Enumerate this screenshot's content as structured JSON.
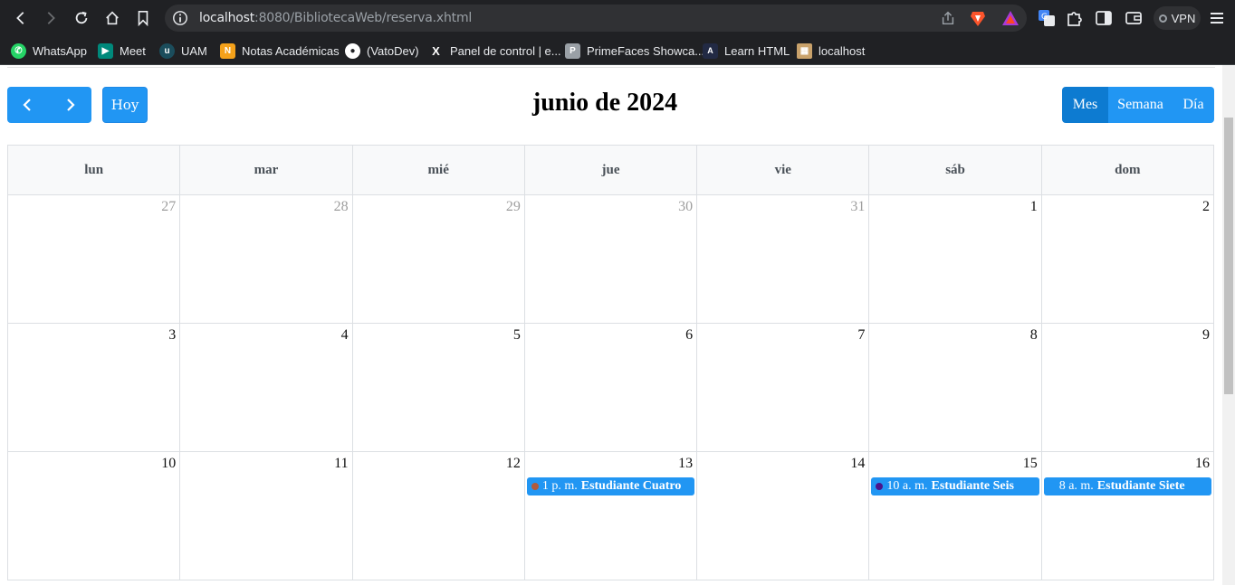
{
  "browser": {
    "url_host": "localhost",
    "url_rest": ":8080/BibliotecaWeb/reserva.xhtml",
    "vpn_label": "VPN",
    "bookmarks": [
      {
        "label": "WhatsApp",
        "icon": "whatsapp-icon",
        "color": "#25d366"
      },
      {
        "label": "Meet",
        "icon": "meet-icon",
        "color": "#00897b"
      },
      {
        "label": "UAM",
        "icon": "uam-icon",
        "color": "#1b4d5c"
      },
      {
        "label": "Notas Académicas",
        "icon": "notas-icon",
        "color": "#f4a11a"
      },
      {
        "label": "(VatoDev)",
        "icon": "github-icon",
        "color": "#ffffff"
      },
      {
        "label": "Panel de control | e...",
        "icon": "x-icon",
        "color": "#ffffff"
      },
      {
        "label": "PrimeFaces Showca...",
        "icon": "primefaces-icon",
        "color": "#9aa0a6"
      },
      {
        "label": "Learn HTML",
        "icon": "learn-html-icon",
        "color": "#222a44"
      },
      {
        "label": "localhost",
        "icon": "localhost-icon",
        "color": "#c9a26b"
      }
    ]
  },
  "calendar": {
    "title": "junio de 2024",
    "today_label": "Hoy",
    "views": [
      {
        "label": "Mes",
        "active": true
      },
      {
        "label": "Semana",
        "active": false
      },
      {
        "label": "Día",
        "active": false
      }
    ],
    "weekdays": [
      "lun",
      "mar",
      "mié",
      "jue",
      "vie",
      "sáb",
      "dom"
    ],
    "weeks": [
      [
        {
          "day": "27",
          "other": true
        },
        {
          "day": "28",
          "other": true
        },
        {
          "day": "29",
          "other": true
        },
        {
          "day": "30",
          "other": true
        },
        {
          "day": "31",
          "other": true
        },
        {
          "day": "1"
        },
        {
          "day": "2"
        }
      ],
      [
        {
          "day": "3"
        },
        {
          "day": "4"
        },
        {
          "day": "5"
        },
        {
          "day": "6"
        },
        {
          "day": "7"
        },
        {
          "day": "8"
        },
        {
          "day": "9"
        }
      ],
      [
        {
          "day": "10"
        },
        {
          "day": "11"
        },
        {
          "day": "12"
        },
        {
          "day": "13",
          "event": {
            "time": "1 p. m.",
            "title": "Estudiante Cuatro",
            "dot_color": "#b05a3c"
          }
        },
        {
          "day": "14"
        },
        {
          "day": "15",
          "event": {
            "time": "10 a. m.",
            "title": "Estudiante Seis",
            "dot_color": "#4a148c"
          }
        },
        {
          "day": "16",
          "event": {
            "time": "8 a. m.",
            "title": "Estudiante Siete",
            "dot_color": "#2196f3"
          }
        }
      ]
    ],
    "colors": {
      "primary": "#2196f3",
      "active": "#0d7bd1"
    }
  }
}
